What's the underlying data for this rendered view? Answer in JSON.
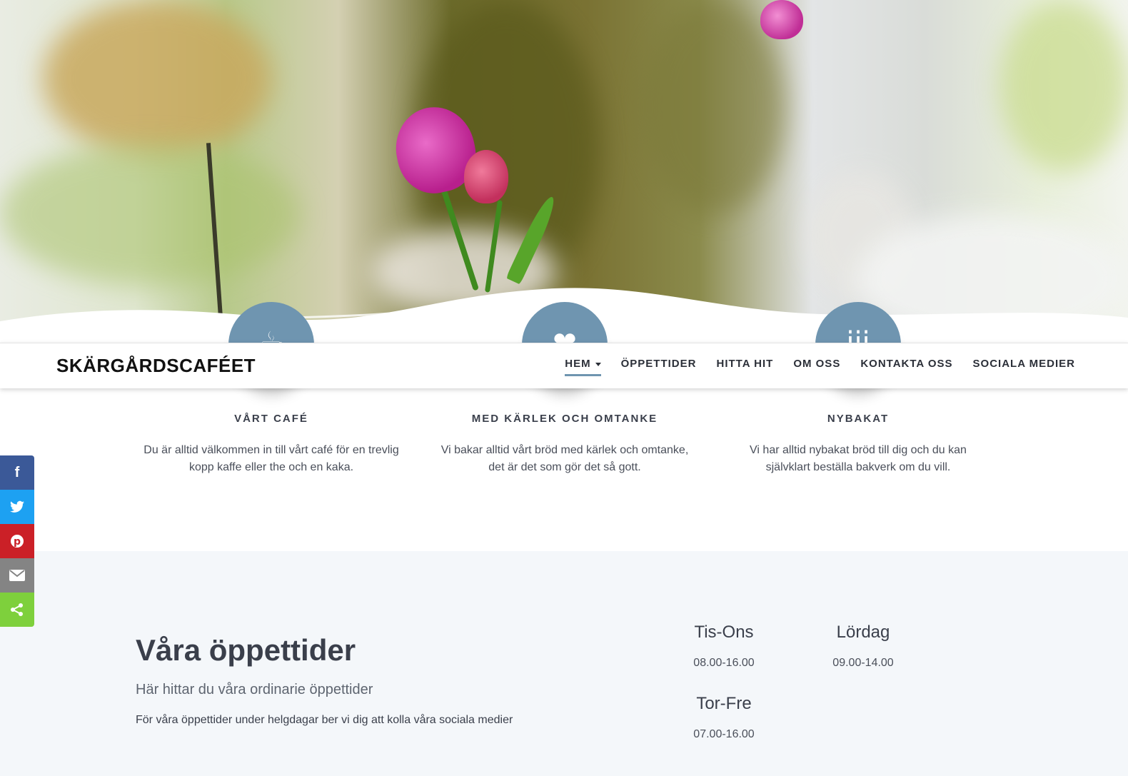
{
  "site": {
    "logo": "SKÄRGÅRDSCAFÉET"
  },
  "nav": {
    "items": [
      {
        "label": "HEM",
        "active": true,
        "has_dropdown": true
      },
      {
        "label": "ÖPPETTIDER"
      },
      {
        "label": "HITTA HIT"
      },
      {
        "label": "OM OSS"
      },
      {
        "label": "KONTAKTA OSS"
      },
      {
        "label": "SOCIALA MEDIER"
      }
    ]
  },
  "features": [
    {
      "icon": "coffee-cup-icon",
      "title": "VÅRT CAFÉ",
      "text": "Du är alltid välkommen in till vårt café för en trevlig kopp kaffe eller the och en kaka."
    },
    {
      "icon": "heart-icon",
      "title": "MED KÄRLEK OCH OMTANKE",
      "text": "Vi bakar alltid vårt bröd med kärlek och omtanke, det är det som gör det så gott."
    },
    {
      "icon": "birthday-cake-icon",
      "title": "NYBAKAT",
      "text": "Vi har alltid nybakat bröd till dig och du kan självklart beställa bakverk om du vill."
    }
  ],
  "hours": {
    "title": "Våra öppettider",
    "subtitle": "Här hittar du våra ordinarie öppettider",
    "note": "För våra öppettider under helgdagar ber vi dig att kolla våra sociala medier",
    "schedule": [
      {
        "day": "Tis-Ons",
        "time": "08.00-16.00"
      },
      {
        "day": "Lördag",
        "time": "09.00-14.00"
      },
      {
        "day": "Tor-Fre",
        "time": "07.00-16.00"
      }
    ]
  },
  "social": [
    {
      "name": "facebook-icon",
      "color": "#3b5998"
    },
    {
      "name": "twitter-icon",
      "color": "#1da1f2"
    },
    {
      "name": "pinterest-icon",
      "color": "#cb2027"
    },
    {
      "name": "email-icon",
      "color": "#848484"
    },
    {
      "name": "share-icon",
      "color": "#7ed03c"
    }
  ],
  "colors": {
    "accent": "#6f95b0",
    "section_bg": "#f4f7fa"
  }
}
